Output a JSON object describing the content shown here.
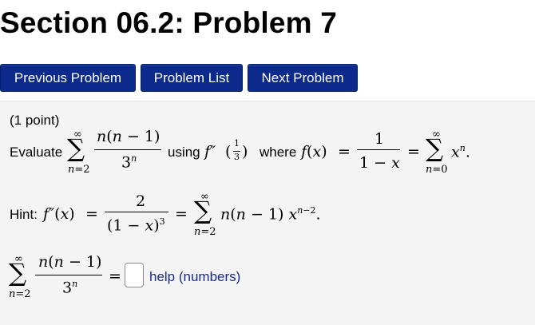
{
  "page": {
    "title": "Section 06.2: Problem 7"
  },
  "nav": {
    "previous_label": "Previous Problem",
    "list_label": "Problem List",
    "next_label": "Next Problem"
  },
  "problem": {
    "points": "(1 point)",
    "evaluate_label": "Evaluate",
    "using_label": "using",
    "where_label": "where",
    "hint_label": "Hint:",
    "help_label": "help (numbers)"
  },
  "colors": {
    "button_bg": "#0b2a8c",
    "panel_bg": "#f4f4f4",
    "help_link": "#1b2a8c"
  }
}
